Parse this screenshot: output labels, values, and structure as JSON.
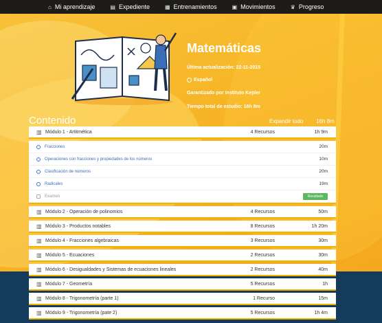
{
  "nav": [
    {
      "icon": "home-icon",
      "glyph": "⌂",
      "label": "Mi aprendizaje"
    },
    {
      "icon": "folder-icon",
      "glyph": "▤",
      "label": "Expediente"
    },
    {
      "icon": "briefcase-icon",
      "glyph": "▦",
      "label": "Entrenamientos"
    },
    {
      "icon": "transfer-icon",
      "glyph": "▣",
      "label": "Movimientos"
    },
    {
      "icon": "progress-icon",
      "glyph": "♛",
      "label": "Progreso"
    }
  ],
  "course": {
    "title": "Matemáticas",
    "updated": "Última actualización: 22-11-2015",
    "language": "Español",
    "guarantee": "Garantizado por Instituto Kepler",
    "total_time": "Tiempo total de estudio: 16h 8m"
  },
  "content": {
    "heading": "Contenido",
    "expand_label": "Expandir todo",
    "total_duration": "16h 8m"
  },
  "expanded_module": {
    "title": "Módulo 1 - Artitmética",
    "resources": "4 Recursos",
    "duration": "1h 9m",
    "lessons": [
      {
        "title": "Fracciones",
        "duration": "20m"
      },
      {
        "title": "Operaciones con fracciones y propiedades de los números",
        "duration": "10m"
      },
      {
        "title": "Clasificación de números",
        "duration": "20m"
      },
      {
        "title": "Radicales",
        "duration": "19m"
      }
    ],
    "exam": {
      "title": "Examen",
      "button": "Resultado"
    }
  },
  "modules": [
    {
      "title": "Módulo 2 - Operación de polinomios",
      "resources": "4 Recursos",
      "duration": "50m"
    },
    {
      "title": "Módulo 3 - Productos notables",
      "resources": "8 Recursos",
      "duration": "1h 20m"
    },
    {
      "title": "Módulo 4 - Fracciones algebraicas",
      "resources": "3 Recursos",
      "duration": "30m"
    },
    {
      "title": "Módulo 5 - Ecuaciones",
      "resources": "2 Recursos",
      "duration": "30m"
    },
    {
      "title": "Módulo 6 - Desigualdades y Sistemas de ecuaciones lineales",
      "resources": "2 Recursos",
      "duration": "40m"
    },
    {
      "title": "Módulo 7 - Geometría",
      "resources": "5 Recursos",
      "duration": "1h"
    },
    {
      "title": "Módulo 8 - Trigonometría (parte 1)",
      "resources": "1 Recurso",
      "duration": "15m"
    },
    {
      "title": "Módulo 9 - Trigonometría (pate 2)",
      "resources": "5 Recursos",
      "duration": "1h 4m"
    }
  ]
}
